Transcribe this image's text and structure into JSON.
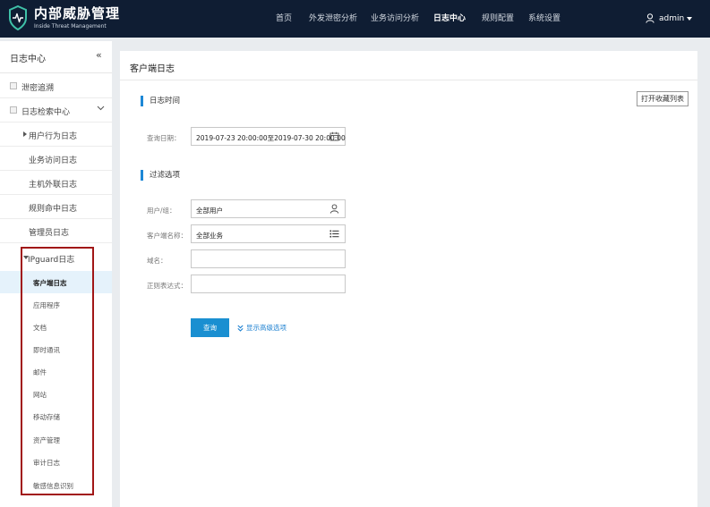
{
  "header": {
    "title": "内部威胁管理",
    "subtitle": "Inside Threat Management",
    "nav": [
      "首页",
      "外发泄密分析",
      "业务访问分析",
      "日志中心",
      "规则配置",
      "系统设置"
    ],
    "active_nav": "日志中心",
    "user": "admin"
  },
  "sidebar": {
    "title": "日志中心",
    "collapse": "«",
    "items": [
      {
        "label": "泄密追溯"
      },
      {
        "label": "日志检索中心"
      },
      {
        "label": "用户行为日志"
      },
      {
        "label": "业务访问日志"
      },
      {
        "label": "主机外联日志"
      },
      {
        "label": "规则命中日志"
      },
      {
        "label": "管理员日志"
      },
      {
        "label": "IPguard日志"
      }
    ],
    "ipguard_items": [
      "客户端日志",
      "应用程序",
      "文档",
      "即时通讯",
      "邮件",
      "网站",
      "移动存储",
      "资产管理",
      "审计日志",
      "敏感信息识别"
    ],
    "active_item": "客户端日志"
  },
  "main": {
    "title": "客户端日志",
    "sections": {
      "time": "日志时间",
      "filter": "过滤选项"
    },
    "favorite_button": "打开收藏列表",
    "fields": {
      "query_date": {
        "label": "查询日期：",
        "value": "2019-07-23 20:00:00至2019-07-30 20:00:00"
      },
      "user_group": {
        "label": "用户/组：",
        "value": "全部用户"
      },
      "client_name": {
        "label": "客户端名称：",
        "value": "全部业务"
      },
      "domain": {
        "label": "域名：",
        "value": ""
      },
      "regex": {
        "label": "正则表达式：",
        "value": ""
      }
    },
    "query_button": "查询",
    "advanced_link": "显示高级选项"
  },
  "colors": {
    "topbar": "#0f1d33",
    "accent": "#1a8fd1",
    "highlight_box": "#a11616",
    "active_row": "#e5f2fb"
  }
}
